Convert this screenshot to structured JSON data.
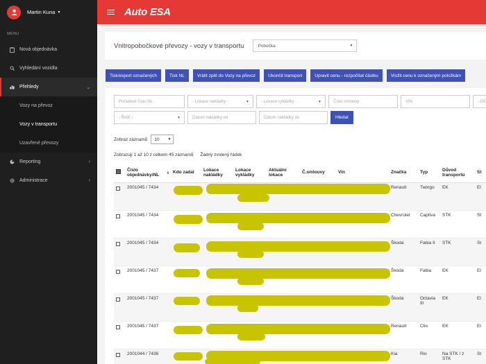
{
  "user": {
    "name": "Martin Kuna"
  },
  "sidebar": {
    "menu_title": "MENU",
    "items": [
      {
        "label": "Nová objednávka",
        "icon": "clipboard-icon"
      },
      {
        "label": "Vyhledání vozidla",
        "icon": "search-icon"
      },
      {
        "label": "Přehledy",
        "icon": "bar-chart-icon"
      },
      {
        "label": "Reporting",
        "icon": "pie-chart-icon"
      },
      {
        "label": "Administrace",
        "icon": "gear-icon"
      }
    ],
    "subitems": [
      "Vozy na převoz",
      "Vozy v transportu",
      "Uzavřené převozy"
    ]
  },
  "header": {
    "logo": "Auto ESA"
  },
  "page": {
    "title": "Vnitropobočkové převozy - vozy v transportu",
    "branch_select": "Pobočka"
  },
  "actions": [
    "Tisk/export označených",
    "Tisk NL",
    "Vrátit zpět do Vozy na převoz",
    "Ukončit transport",
    "Upravit cenu - rozpočítat částku",
    "Vložit cenu k označeným položkám"
  ],
  "filters": {
    "order_no": "Pořadové číslo NL",
    "load_from": "- Lokace nakládky -",
    "load_to": "- Lokace vykládky -",
    "contract": "Číslo smlouvy",
    "vin": "VIN",
    "extra": "- Dů",
    "driver": "- Řidič -",
    "date_from": "Datum nakládky od",
    "date_to": "Datum nakládky do",
    "search_btn": "Hledat"
  },
  "list": {
    "length_label": "Zobraz záznamů",
    "length_value": "10",
    "info": "Zobrazuji 1 až 10 z celkem 45 záznamů",
    "selected_info": "Žádný zvolený řádek"
  },
  "table": {
    "headers": {
      "order": "Číslo objednávky/NL",
      "who": "Kdo zadal",
      "load": "Lokace nakládky",
      "unload": "Lokace vykládky",
      "current": "Aktuální lokace",
      "contract": "Č.smlouvy",
      "vin": "Vin",
      "brand": "Značka",
      "type": "Typ",
      "reason": "Důvod transportu",
      "last": "St"
    },
    "rows": [
      {
        "order": "2001045 / 7434",
        "brand": "Renault",
        "type": "Twingo",
        "reason": "EK",
        "last": "El"
      },
      {
        "order": "2001045 / 7434",
        "brand": "Chevrolet",
        "type": "Captiva",
        "reason": "STK",
        "last": "St"
      },
      {
        "order": "2001045 / 7434",
        "brand": "Škoda",
        "type": "Fabia II",
        "reason": "STK",
        "last": "St"
      },
      {
        "order": "2001045 / 7437",
        "brand": "Škoda",
        "type": "Fabia",
        "reason": "EK",
        "last": "El"
      },
      {
        "order": "2001045 / 7437",
        "brand": "Škoda",
        "type": "Octavia III",
        "reason": "EK",
        "last": "El"
      },
      {
        "order": "2001045 / 7437",
        "brand": "Renault",
        "type": "Clio",
        "reason": "EK",
        "last": "El"
      },
      {
        "order": "2001044 / 7436",
        "brand": "Kia",
        "type": "Rio",
        "reason": "Na STK / z STK",
        "last": "St"
      }
    ]
  }
}
